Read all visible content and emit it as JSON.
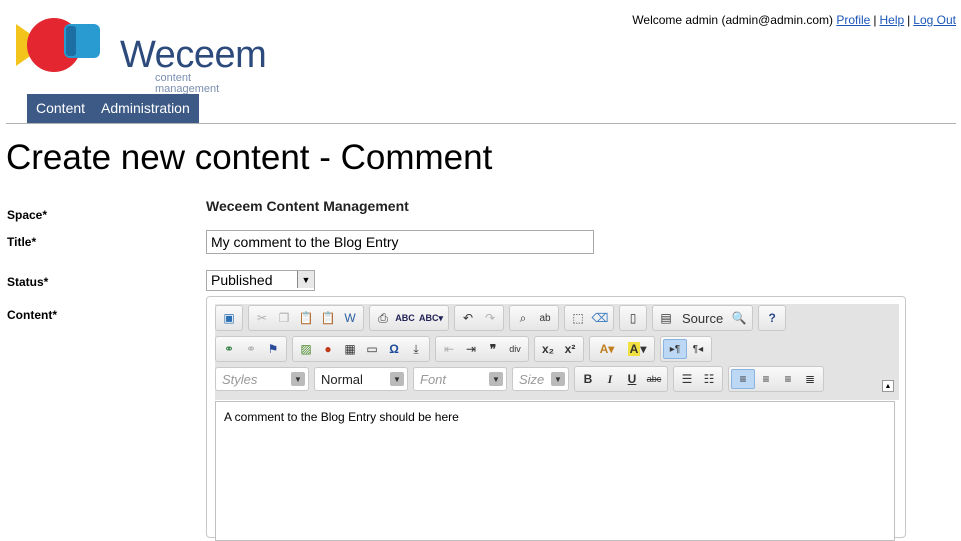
{
  "header": {
    "logo_text": "Weceem",
    "logo_sub": "content management",
    "welcome": "Welcome admin (admin@admin.com)",
    "links": [
      "Profile",
      "Help",
      "Log Out"
    ],
    "colors": {
      "nav": "#3d5a86",
      "logo_text": "#2c4a7c",
      "link": "#1a56b8"
    }
  },
  "nav": {
    "items": [
      "Content",
      "Administration"
    ]
  },
  "page": {
    "title": "Create new content - Comment"
  },
  "form": {
    "space_label": "Space*",
    "space_value": "Weceem Content Management",
    "title_label": "Title*",
    "title_value": "My comment to the Blog Entry",
    "status_label": "Status*",
    "status_value": "Published",
    "content_label": "Content*"
  },
  "editor": {
    "source_label": "Source",
    "format_combo": "Normal",
    "styles_combo": "Styles",
    "font_combo": "Font",
    "size_combo": "Size",
    "content_text": "A comment to the Blog Entry should be here"
  }
}
